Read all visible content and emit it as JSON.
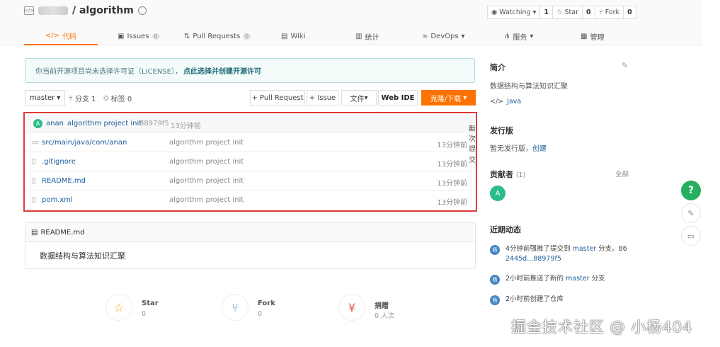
{
  "header": {
    "repo_name": "/ algorithm",
    "watching_label": "Watching",
    "watching_count": "1",
    "star_label": "Star",
    "star_count": "0",
    "fork_label": "Fork",
    "fork_count": "0"
  },
  "tabs": [
    {
      "label": "代码",
      "icon": "code-icon"
    },
    {
      "label": "Issues",
      "count": "0",
      "icon": "issues-icon"
    },
    {
      "label": "Pull Requests",
      "count": "0",
      "icon": "pull-request-icon"
    },
    {
      "label": "Wiki",
      "icon": "wiki-icon"
    },
    {
      "label": "统计",
      "icon": "chart-icon"
    },
    {
      "label": "DevOps",
      "icon": "devops-icon"
    },
    {
      "label": "服务",
      "icon": "service-icon"
    },
    {
      "label": "管理",
      "icon": "manage-icon"
    }
  ],
  "notice": {
    "text": "你当前开源项目尚未选择许可证（LICENSE），",
    "link": "点此选择并创建开源许可"
  },
  "toolbar": {
    "branch": "master",
    "branches": "分支 1",
    "tags": "标签 0",
    "pull_request": "+ Pull Request",
    "issue": "+ Issue",
    "files": "文件",
    "web_ide": "Web IDE",
    "clone": "克隆/下载"
  },
  "commit": {
    "avatar": "A",
    "author": "anan",
    "message": "algorithm project init",
    "hash": "88979f5",
    "time": "13分钟前",
    "count": "1 次提交"
  },
  "files": [
    {
      "name": "src/main/java/com/anan",
      "message": "algorithm project init",
      "time": "13分钟前",
      "icon": "folder-icon"
    },
    {
      "name": ".gitignore",
      "message": "algorithm project init",
      "time": "13分钟前",
      "icon": "file-icon"
    },
    {
      "name": "README.md",
      "message": "algorithm project init",
      "time": "13分钟前",
      "icon": "file-icon"
    },
    {
      "name": "pom.xml",
      "message": "algorithm project init",
      "time": "13分钟前",
      "icon": "file-icon"
    }
  ],
  "readme": {
    "title": "README.md",
    "content": "数据结构与算法知识汇聚"
  },
  "stats": [
    {
      "title": "Star",
      "value": "0",
      "icon": "star-icon",
      "color": "#f5a623"
    },
    {
      "title": "Fork",
      "value": "0",
      "icon": "fork-icon",
      "color": "#4a90e2"
    },
    {
      "title": "捐赠",
      "value": "0 人次",
      "icon": "donate-icon",
      "color": "#e05a5a"
    }
  ],
  "sidebar": {
    "intro_title": "简介",
    "intro_text": "数据结构与算法知识汇聚",
    "language": "Java",
    "release_title": "发行版",
    "release_text": "暂无发行版，",
    "release_link": "创建",
    "contributors_title": "贡献者",
    "contributors_count": "(1)",
    "contributors_all": "全部",
    "contributor_avatar": "A",
    "activity_title": "近期动态",
    "activity": [
      {
        "avatar": "杨",
        "prefix": "4分钟前强推了提交到 ",
        "branch": "master",
        "suffix": " 分支。86",
        "line2": "2445d...88979f5"
      },
      {
        "avatar": "杨",
        "prefix": "2小时前推送了新的 ",
        "branch": "master",
        "suffix": " 分支",
        "line2": ""
      },
      {
        "avatar": "杨",
        "prefix": "2小时前创建了仓库",
        "branch": "",
        "suffix": "",
        "line2": ""
      }
    ]
  },
  "floating": {
    "help": "?"
  },
  "watermark": "掘金技术社区 @ 小杨404",
  "colors": {
    "accent": "#fe7300",
    "link": "#1a5c9e",
    "highlight_border": "#e03a3a",
    "help_button": "#27ae60"
  }
}
